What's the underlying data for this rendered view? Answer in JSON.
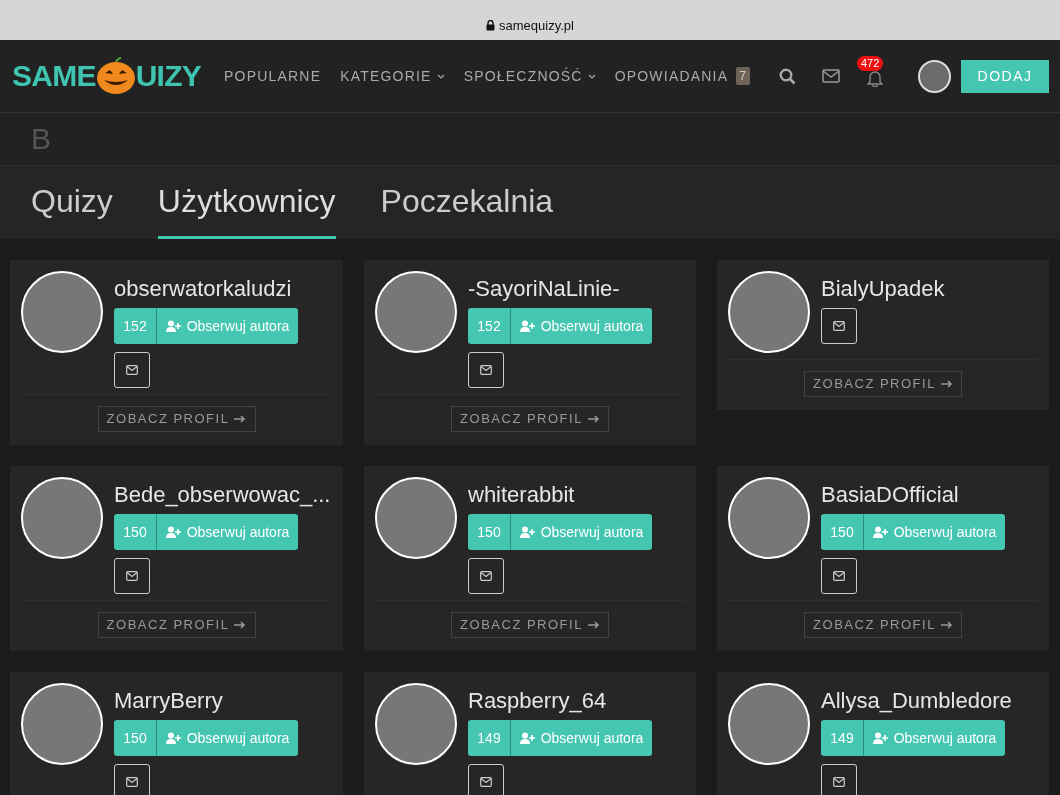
{
  "browser_bar": {
    "address": "samequizy.pl"
  },
  "logo": {
    "left": "SAME",
    "right": "UIZY"
  },
  "nav": [
    {
      "label": "POPULARNE",
      "kind": "link"
    },
    {
      "label": "KATEGORIE",
      "kind": "dropdown"
    },
    {
      "label": "SPOŁECZNOŚĆ",
      "kind": "dropdown"
    },
    {
      "label": "OPOWIADANIA",
      "kind": "link",
      "badge": "7"
    }
  ],
  "notifications": {
    "count": "472"
  },
  "add_button": "DODAJ",
  "search": {
    "value": "B"
  },
  "tabs": [
    {
      "label": "Quizy",
      "selected": false
    },
    {
      "label": "Użytkownicy",
      "selected": true
    },
    {
      "label": "Poczekalnia",
      "selected": false
    }
  ],
  "users": [
    {
      "name": "obserwatorkaludzi",
      "followers": "152",
      "follow_label": "Obserwuj autora",
      "profile_label": "ZOBACZ PROFIL"
    },
    {
      "name": "-SayoriNaLinie-",
      "followers": "152",
      "follow_label": "Obserwuj autora",
      "profile_label": "ZOBACZ PROFIL"
    },
    {
      "name": "BialyUpadek",
      "profile_label": "ZOBACZ PROFIL"
    },
    {
      "name": "Bede_obserwowac_...",
      "followers": "150",
      "follow_label": "Obserwuj autora",
      "profile_label": "ZOBACZ PROFIL"
    },
    {
      "name": "whiterabbit",
      "followers": "150",
      "follow_label": "Obserwuj autora",
      "profile_label": "ZOBACZ PROFIL"
    },
    {
      "name": "BasiaDOfficial",
      "followers": "150",
      "follow_label": "Obserwuj autora",
      "profile_label": "ZOBACZ PROFIL"
    },
    {
      "name": "MarryBerry",
      "followers": "150",
      "follow_label": "Obserwuj autora"
    },
    {
      "name": "Raspberry_64",
      "followers": "149",
      "follow_label": "Obserwuj autora"
    },
    {
      "name": "Allysa_Dumbledore",
      "followers": "149",
      "follow_label": "Obserwuj autora"
    }
  ]
}
